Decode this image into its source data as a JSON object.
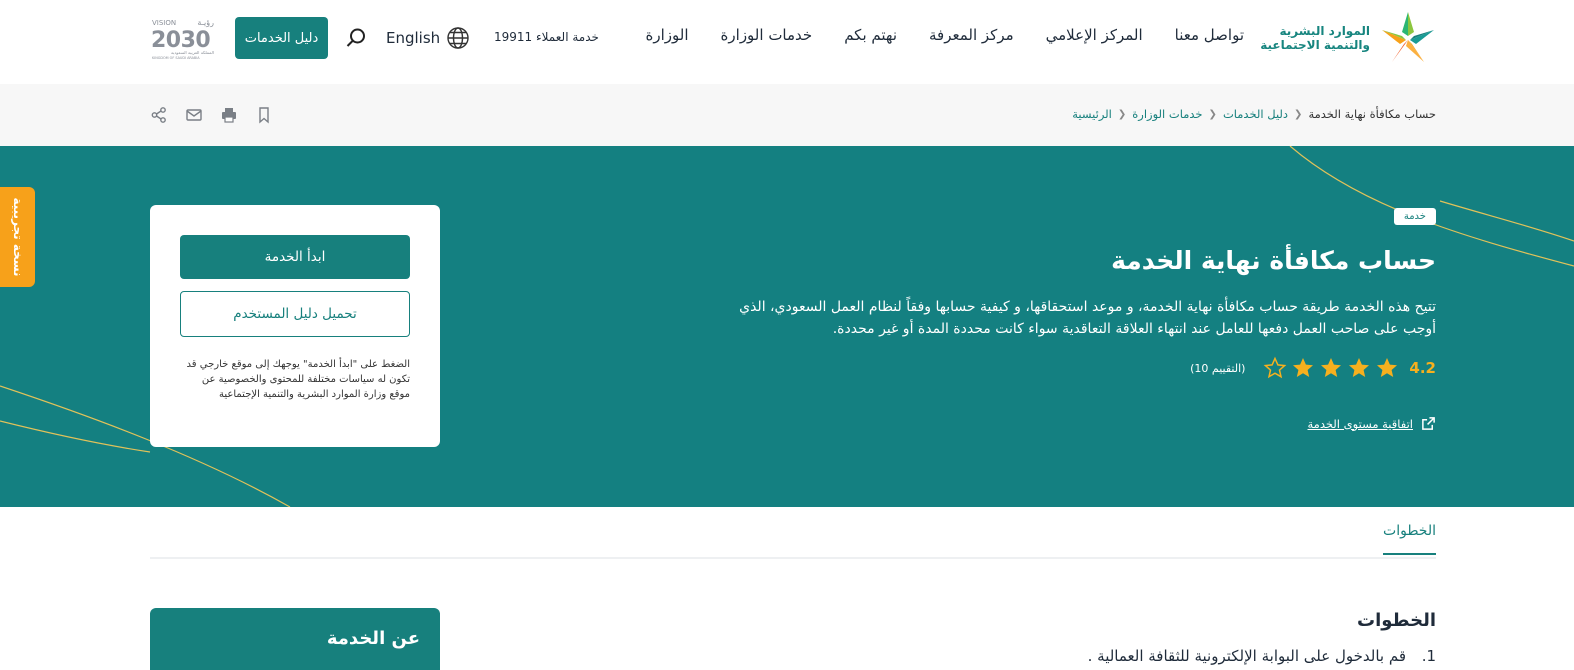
{
  "brand": {
    "ministry_name_line1": "الموارد البشرية",
    "ministry_name_line2": "والتنمية الاجتماعية",
    "vision_label": "VISION",
    "vision_year": "2030",
    "vision_arabic": "رؤيـة",
    "vision_kingdom_ar": "المملكة العربية السعودية",
    "vision_kingdom_en": "KINGDOM OF SAUDI ARABIA",
    "colors": {
      "primary": "#17807d",
      "accent": "#f7a11a",
      "hero": "#148081"
    }
  },
  "nav": {
    "items": [
      "الوزارة",
      "خدمات الوزارة",
      "نهتم بكم",
      "مركز المعرفة",
      "المركز الإعلامي",
      "تواصل معنا"
    ],
    "hotline": "خدمة العملاء 19911",
    "language": "English",
    "services_guide": "دليل الخدمات"
  },
  "breadcrumb": {
    "items": [
      "الرئيسية",
      "خدمات الوزارة",
      "دليل الخدمات"
    ],
    "current": "حساب مكافأة نهاية الخدمة"
  },
  "tools": [
    "bookmark-icon",
    "print-icon",
    "mail-icon",
    "share-icon"
  ],
  "beta_tab": "نسخة تجريبية",
  "hero": {
    "tag": "خدمة",
    "title": "حساب مكافأة نهاية الخدمة",
    "description": "تتيح هذه الخدمة طريقة حساب مكافأة نهاية الخدمة، و موعد استحقاقها، و كيفية حسابها وفقاً لنظام العمل السعودي، الذي أوجب على صاحب العمل دفعها للعامل عند انتهاء العلاقة التعاقدية سواء كانت محددة المدة أو غير محددة.",
    "rating_value": "4.2",
    "rating_stars": 4,
    "rating_max": 5,
    "rating_count": "(التقييم 10)",
    "sla_link": "اتفاقية مستوى الخدمة"
  },
  "card": {
    "start_button": "ابدأ الخدمة",
    "manual_button": "تحميل دليل المستخدم",
    "note": "الضغط على \"ابدأ الخدمة\" يوجهك إلى موقع خارجي قد تكون له سياسات مختلفة للمحتوى والخصوصية عن موقع وزارة الموارد البشرية والتنمية الإجتماعية"
  },
  "tabs": {
    "active": "الخطوات"
  },
  "steps": {
    "title": "الخطوات",
    "items": [
      "قم بالدخول على البوابة الإلكترونية للثقافة العمالية ."
    ]
  },
  "about": {
    "title": "عن الخدمة"
  }
}
